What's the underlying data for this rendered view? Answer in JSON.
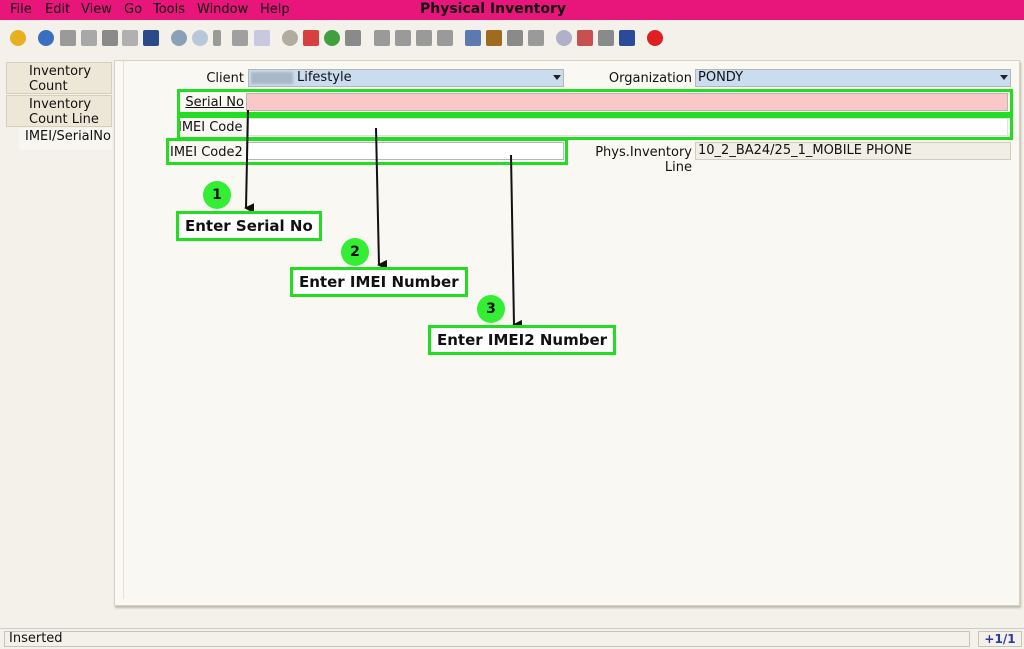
{
  "menubar": {
    "items": [
      "File",
      "Edit",
      "View",
      "Go",
      "Tools",
      "Window",
      "Help"
    ],
    "title": "Physical Inventory"
  },
  "toolbar": {
    "icons": [
      "undo-icon",
      "help-icon",
      "new-icon",
      "copy-icon",
      "delete-icon",
      "delete-selection-icon",
      "save-icon",
      "refresh-icon",
      "find-icon",
      "attachment-icon",
      "chat-icon",
      "history-icon",
      "home-icon",
      "home-page-icon",
      "back-icon",
      "forward-icon",
      "first-record-icon",
      "previous-record-icon",
      "next-record-icon",
      "last-record-icon",
      "report-icon",
      "archive-icon",
      "print-icon",
      "print-preview-icon",
      "zoom-across-icon",
      "request-icon",
      "product-info-icon",
      "workflow-icon",
      "exit-icon"
    ]
  },
  "tabs": [
    {
      "label": "Inventory Count"
    },
    {
      "label": "Inventory Count Line"
    },
    {
      "label": "IMEI/SerialNo"
    }
  ],
  "form": {
    "client_label": "Client",
    "client_value": "Lifestyle",
    "org_label": "Organization",
    "org_value": "PONDY",
    "serial_label": "Serial No",
    "serial_value": "",
    "imei_label": "IMEI Code",
    "imei_value": "",
    "imei2_label": "IMEI Code2",
    "imei2_value": "",
    "phys_line_label": "Phys.Inventory Line",
    "phys_line_value": "10_2_BA24/25_1_MOBILE PHONE"
  },
  "annotations": [
    {
      "number": "1",
      "text": "Enter Serial No"
    },
    {
      "number": "2",
      "text": "Enter IMEI Number"
    },
    {
      "number": "3",
      "text": "Enter IMEI2 Number"
    }
  ],
  "colors": {
    "menubar": "#e8157a",
    "highlight": "#22dd22",
    "mandatory_field": "#f9c8c8",
    "combo_field": "#c9dcf0"
  },
  "status": {
    "text": "Inserted",
    "record": "+1/1"
  }
}
